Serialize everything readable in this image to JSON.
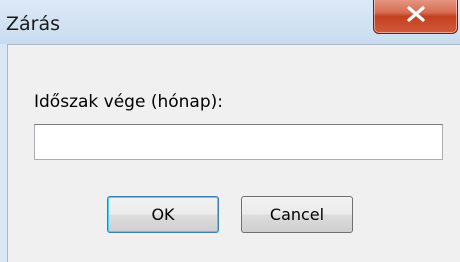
{
  "window": {
    "title": "Zárás",
    "close_symbol": "close-icon"
  },
  "form": {
    "label": "Időszak vége (hónap):",
    "input_value": "",
    "input_placeholder": ""
  },
  "buttons": {
    "ok_label": "OK",
    "cancel_label": "Cancel"
  },
  "colors": {
    "close_button": "#c3401f",
    "title_bar": "#c9dcf0",
    "client_background": "#f0f0f0"
  }
}
